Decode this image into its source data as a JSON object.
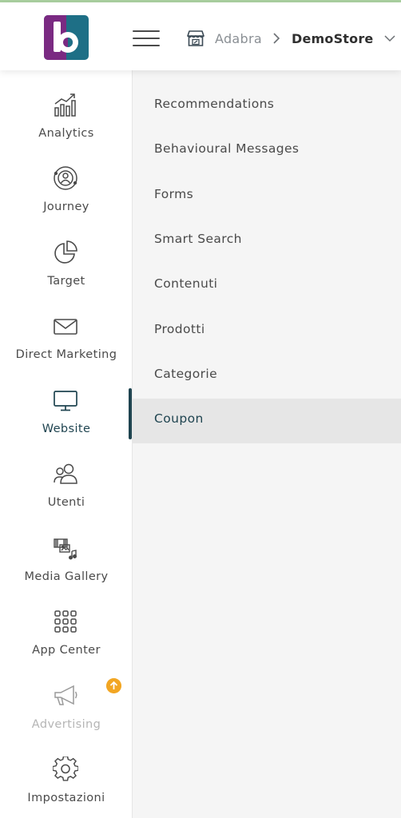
{
  "header": {
    "organization": "Adabra",
    "store": "DemoStore"
  },
  "icons": {
    "logo": "adabra-b-logo",
    "menu": "hamburger-icon",
    "store": "store-icon",
    "separator": "chevron-right-icon",
    "dropdown": "chevron-down-icon"
  },
  "colors": {
    "accent": "#1f4450",
    "logo_purple": "#7a2a82",
    "logo_teal": "#1e6f86",
    "badge": "#f2a623",
    "top_line": "#a9cf9f"
  },
  "sidebar": {
    "items": [
      {
        "label": "Analytics",
        "icon": "analytics-icon"
      },
      {
        "label": "Journey",
        "icon": "journey-icon"
      },
      {
        "label": "Target",
        "icon": "target-pie-icon"
      },
      {
        "label": "Direct Marketing",
        "icon": "envelope-icon"
      },
      {
        "label": "Website",
        "icon": "monitor-icon",
        "active": true
      },
      {
        "label": "Utenti",
        "icon": "users-icon"
      },
      {
        "label": "Media Gallery",
        "icon": "media-gallery-icon"
      },
      {
        "label": "App Center",
        "icon": "grid-icon"
      },
      {
        "label": "Advertising",
        "icon": "megaphone-icon",
        "disabled": true,
        "badge": "upgrade-arrow-icon"
      },
      {
        "label": "Impostazioni",
        "icon": "gear-icon"
      }
    ]
  },
  "submenu": {
    "items": [
      {
        "label": "Recommendations"
      },
      {
        "label": "Behavioural Messages"
      },
      {
        "label": "Forms"
      },
      {
        "label": "Smart Search"
      },
      {
        "label": "Contenuti"
      },
      {
        "label": "Prodotti"
      },
      {
        "label": "Categorie"
      },
      {
        "label": "Coupon",
        "selected": true
      }
    ]
  }
}
